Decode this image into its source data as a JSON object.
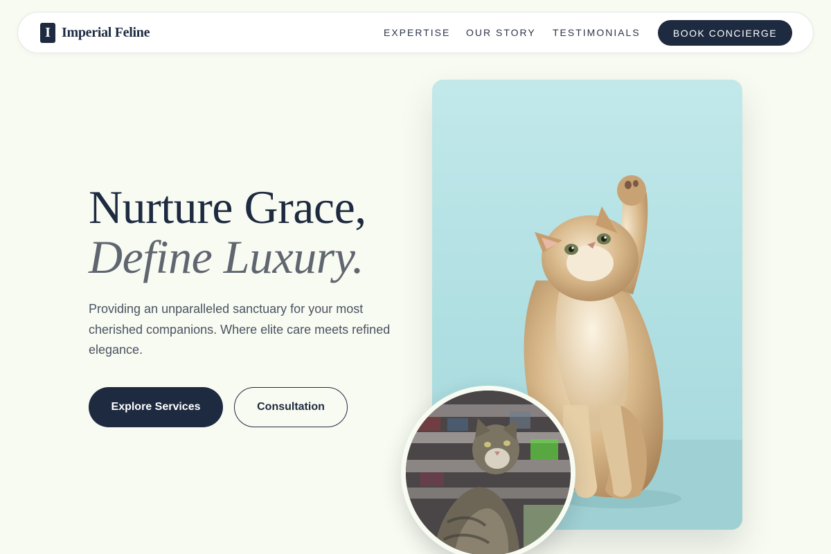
{
  "header": {
    "brand_letter": "I",
    "brand_name": "Imperial Feline",
    "nav": [
      "EXPERTISE",
      "OUR STORY",
      "TESTIMONIALS"
    ],
    "cta": "BOOK CONCIERGE"
  },
  "hero": {
    "headline_line1": "Nurture Grace,",
    "headline_line2": "Define Luxury.",
    "subcopy": "Providing an unparalleled sanctuary for your most cherished companions. Where elite care meets refined elegance.",
    "primary_button": "Explore Services",
    "secondary_button": "Consultation"
  },
  "images": {
    "main_photo": "kitten-reaching-up-photo",
    "circle_photo": "tabby-cat-looking-up-photo"
  },
  "colors": {
    "navy": "#1d2a40",
    "background": "#f8fbf1",
    "muted_gray": "#5f6670",
    "photo_backdrop": "#b8e3e5"
  }
}
